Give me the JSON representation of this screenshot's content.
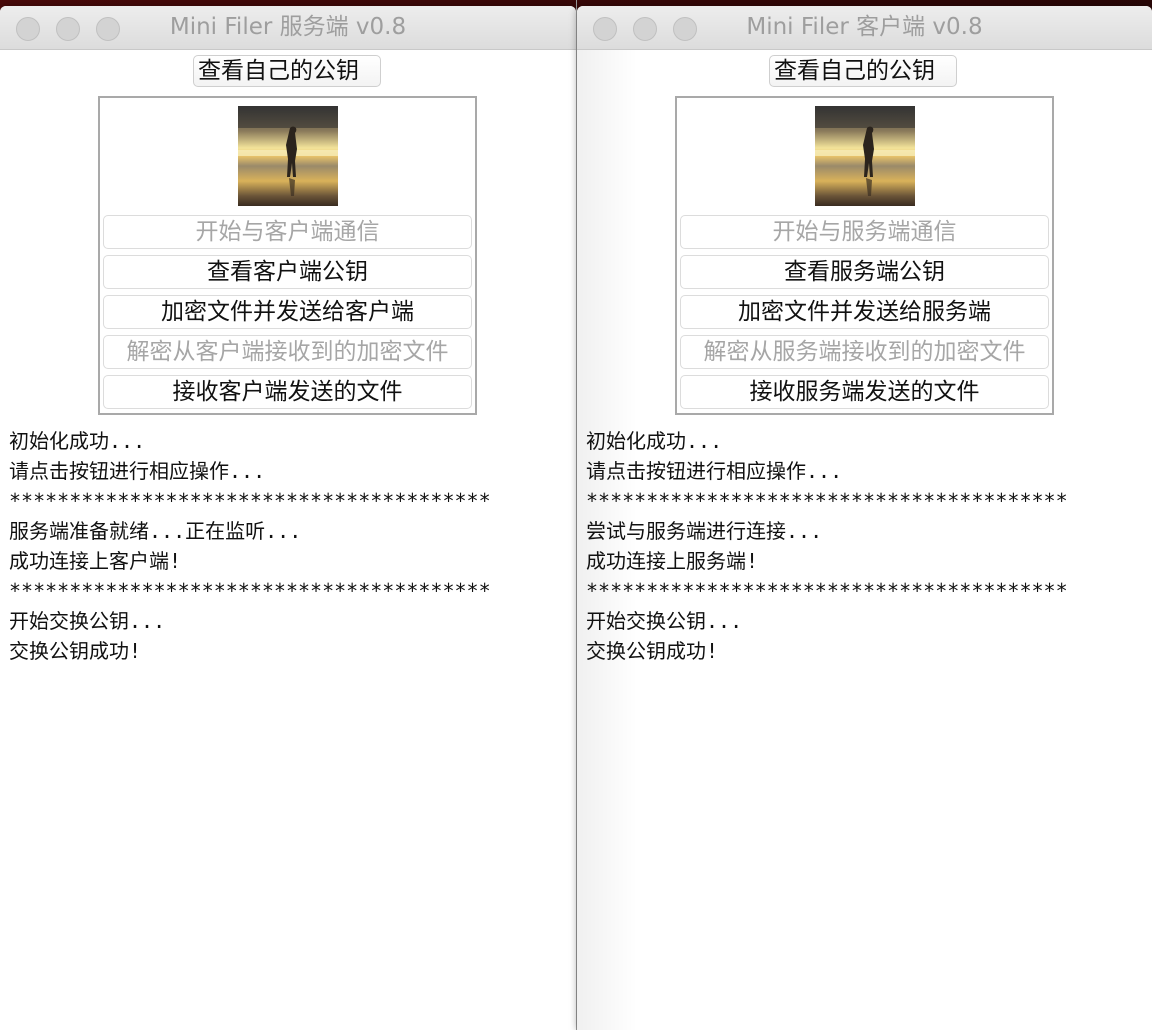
{
  "server_window": {
    "title": "Mini Filer 服务端 v0.8",
    "view_own_key_label": "查看自己的公钥",
    "avatar_icon": "beach-silhouette-photo",
    "buttons": [
      {
        "label": "开始与客户端通信",
        "enabled": false
      },
      {
        "label": "查看客户端公钥",
        "enabled": true
      },
      {
        "label": "加密文件并发送给客户端",
        "enabled": true
      },
      {
        "label": "解密从客户端接收到的加密文件",
        "enabled": false
      },
      {
        "label": "接收客户端发送的文件",
        "enabled": true
      }
    ],
    "log": [
      "初始化成功...",
      "请点击按钮进行相应操作...",
      "****************************************",
      "服务端准备就绪...正在监听...",
      "成功连接上客户端!",
      "****************************************",
      "开始交换公钥...",
      "交换公钥成功!"
    ]
  },
  "client_window": {
    "title": "Mini Filer 客户端 v0.8",
    "view_own_key_label": "查看自己的公钥",
    "avatar_icon": "beach-silhouette-photo",
    "buttons": [
      {
        "label": "开始与服务端通信",
        "enabled": false
      },
      {
        "label": "查看服务端公钥",
        "enabled": true
      },
      {
        "label": "加密文件并发送给服务端",
        "enabled": true
      },
      {
        "label": "解密从服务端接收到的加密文件",
        "enabled": false
      },
      {
        "label": "接收服务端发送的文件",
        "enabled": true
      }
    ],
    "log": [
      "初始化成功...",
      "请点击按钮进行相应操作...",
      "****************************************",
      "尝试与服务端进行连接...",
      "成功连接上服务端!",
      "****************************************",
      "开始交换公钥...",
      "交换公钥成功!"
    ]
  },
  "colors": {
    "title_text": "#9e9e9e",
    "disabled_text": "#a6a6a6",
    "traffic_light": "#d3d3d3"
  }
}
